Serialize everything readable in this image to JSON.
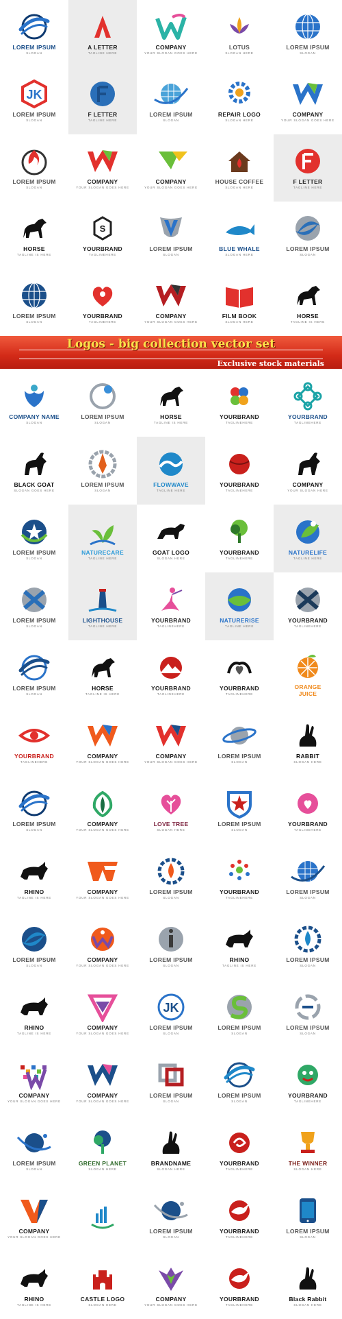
{
  "banner": {
    "title": "Logos - big collection vector set",
    "subtitle": "Exclusive stock materials"
  },
  "logos_top": [
    {
      "icon": "swoosh-circle",
      "c1": "#2a73c9",
      "c2": "#0e3a70",
      "name": "LOREM IPSUM",
      "sub": "SLOGAN",
      "color": "#1b4f8a"
    },
    {
      "icon": "letter-a",
      "c1": "#e2312d",
      "c2": "#333333",
      "name": "A LETTER",
      "sub": "TAGLINE HERE",
      "color": "#222",
      "shade": true
    },
    {
      "icon": "w-ribbon",
      "c1": "#2bb3a6",
      "c2": "#e64f9a",
      "name": "COMPANY",
      "sub": "YOUR SLOGAN GOES HERE",
      "color": "#222"
    },
    {
      "icon": "lotus",
      "c1": "#f0a21c",
      "c2": "#7a4aa8",
      "name": "LOTUS",
      "sub": "SLOGAN HERE",
      "color": "#555"
    },
    {
      "icon": "globe-grid",
      "c1": "#2a73c9",
      "c2": "#9aa3ad",
      "name": "LOREM IPSUM",
      "sub": "SLOGAN",
      "color": "#555"
    },
    {
      "icon": "hex-letter",
      "c1": "#e2312d",
      "c2": "#2a73c9",
      "name": "LOREM IPSUM",
      "sub": "SLOGAN",
      "color": "#555"
    },
    {
      "icon": "letter-f-circle",
      "c1": "#2a6fb8",
      "c2": "#1b4f8a",
      "name": "F LETTER",
      "sub": "TAGLINE HERE",
      "color": "#222",
      "shade": true
    },
    {
      "icon": "globe-swoosh",
      "c1": "#2a73c9",
      "c2": "#4aa3d9",
      "name": "LOREM IPSUM",
      "sub": "SLOGAN",
      "color": "#555"
    },
    {
      "icon": "gear",
      "c1": "#2a73c9",
      "c2": "#f0a21c",
      "name": "REPAIR LOGO",
      "sub": "SLOGAN HERE",
      "color": "#222"
    },
    {
      "icon": "letter-w",
      "c1": "#2a73c9",
      "c2": "#6abf3a",
      "name": "COMPANY",
      "sub": "YOUR SLOGAN GOES HERE",
      "color": "#222"
    },
    {
      "icon": "flame-circle",
      "c1": "#e2312d",
      "c2": "#333333",
      "name": "LOREM IPSUM",
      "sub": "SLOGAN",
      "color": "#555"
    },
    {
      "icon": "letter-w",
      "c1": "#e2312d",
      "c2": "#6abf3a",
      "name": "COMPANY",
      "sub": "YOUR SLOGAN GOES HERE",
      "color": "#222"
    },
    {
      "icon": "fast-arrow",
      "c1": "#6abf3a",
      "c2": "#f0c21c",
      "name": "COMPANY",
      "sub": "YOUR SLOGAN GOES HERE",
      "color": "#222"
    },
    {
      "icon": "house",
      "c1": "#6b3a1e",
      "c2": "#e2312d",
      "name": "HOUSE COFFEE",
      "sub": "SLOGAN HERE",
      "color": "#555"
    },
    {
      "icon": "letter-f-circle",
      "c1": "#e2312d",
      "c2": "#ffffff",
      "name": "F LETTER",
      "sub": "TAGLINE HERE",
      "color": "#222",
      "shade": true
    },
    {
      "icon": "horse",
      "c1": "#111111",
      "c2": "#111111",
      "name": "HORSE",
      "sub": "TAGLINE IS HERE",
      "color": "#111"
    },
    {
      "icon": "s-hex",
      "c1": "#222222",
      "c2": "#222222",
      "name": "YOURBRAND",
      "sub": "TAGLINEHERE",
      "color": "#222"
    },
    {
      "icon": "v-shield",
      "c1": "#2a73c9",
      "c2": "#9aa3ad",
      "name": "LOREM IPSUM",
      "sub": "SLOGAN",
      "color": "#555"
    },
    {
      "icon": "whale",
      "c1": "#1f88c9",
      "c2": "#1f88c9",
      "name": "BLUE WHALE",
      "sub": "SLOGAN HERE",
      "color": "#1b4f8a"
    },
    {
      "icon": "swirl-sphere",
      "c1": "#2a6fb8",
      "c2": "#9aa3ad",
      "name": "LOREM IPSUM",
      "sub": "SLOGAN",
      "color": "#555"
    },
    {
      "icon": "globe-grid",
      "c1": "#1b4f8a",
      "c2": "#2a73c9",
      "name": "LOREM IPSUM",
      "sub": "SLOGAN",
      "color": "#555"
    },
    {
      "icon": "heart-person",
      "c1": "#e2312d",
      "c2": "#222222",
      "name": "YOURBRAND",
      "sub": "TAGLINEHERE",
      "color": "#222"
    },
    {
      "icon": "letter-w",
      "c1": "#b51e22",
      "c2": "#333333",
      "name": "COMPANY",
      "sub": "YOUR SLOGAN GOES HERE",
      "color": "#222"
    },
    {
      "icon": "book",
      "c1": "#e2312d",
      "c2": "#8a1a18",
      "name": "FILM BOOK",
      "sub": "SLOGAN HERE",
      "color": "#222"
    },
    {
      "icon": "horse",
      "c1": "#111111",
      "c2": "#111111",
      "name": "HORSE",
      "sub": "TAGLINE IS HERE",
      "color": "#111"
    }
  ],
  "logos_bottom": [
    {
      "icon": "hands-person",
      "c1": "#2a73c9",
      "c2": "#3aa7c9",
      "name": "COMPANY NAME",
      "sub": "SLOGAN",
      "color": "#1b4f8a"
    },
    {
      "icon": "ring-ball",
      "c1": "#3a8fd9",
      "c2": "#9aa3ad",
      "name": "LOREM IPSUM",
      "sub": "SLOGAN",
      "color": "#555"
    },
    {
      "icon": "horse",
      "c1": "#111111",
      "c2": "#111111",
      "name": "HORSE",
      "sub": "TAGLINE IS HERE",
      "color": "#111"
    },
    {
      "icon": "flower",
      "c1": "#e2312d",
      "c2": "#2a73c9",
      "name": "YOURBRAND",
      "sub": "TAGLINEHERE",
      "color": "#222"
    },
    {
      "icon": "knot",
      "c1": "#1aa3a6",
      "c2": "#1b4f8a",
      "name": "YOURBRAND",
      "sub": "TAGLINEHERE",
      "color": "#1b4f8a"
    },
    {
      "icon": "goat",
      "c1": "#111111",
      "c2": "#111111",
      "name": "BLACK GOAT",
      "sub": "SLOGAN GOES HERE",
      "color": "#111"
    },
    {
      "icon": "rocket-ring",
      "c1": "#e2601c",
      "c2": "#9aa3ad",
      "name": "LOREM IPSUM",
      "sub": "SLOGAN",
      "color": "#555"
    },
    {
      "icon": "wave-circle",
      "c1": "#1f88c9",
      "c2": "#1b4f8a",
      "name": "FLOWWAVE",
      "sub": "TAGLINE HERE",
      "color": "#1f88c9",
      "shade": true
    },
    {
      "icon": "ball-red",
      "c1": "#c9201c",
      "c2": "#7a1210",
      "name": "YOURBRAND",
      "sub": "TAGLINEHERE",
      "color": "#222"
    },
    {
      "icon": "goat",
      "c1": "#111111",
      "c2": "#111111",
      "name": "COMPANY",
      "sub": "YOUR SLOGAN HERE",
      "color": "#111"
    },
    {
      "icon": "star-ring",
      "c1": "#1b4f8a",
      "c2": "#6abf3a",
      "name": "LOREM IPSUM",
      "sub": "SLOGAN",
      "color": "#555"
    },
    {
      "icon": "leaves",
      "c1": "#6abf3a",
      "c2": "#2a73c9",
      "name": "NATURECARE",
      "sub": "TAGLINE HERE",
      "color": "#2a9ad9",
      "shade": true
    },
    {
      "icon": "bull",
      "c1": "#111111",
      "c2": "#111111",
      "name": "GOAT LOGO",
      "sub": "SLOGAN HERE",
      "color": "#111"
    },
    {
      "icon": "tree",
      "c1": "#2f7a2a",
      "c2": "#6abf3a",
      "name": "YOURBRAND",
      "sub": "TAGLINEHERE",
      "color": "#222"
    },
    {
      "icon": "leaf-person",
      "c1": "#2a73c9",
      "c2": "#6abf3a",
      "name": "NATURELIFE",
      "sub": "TAGLINE HERE",
      "color": "#2a73c9",
      "shade": true
    },
    {
      "icon": "x-sphere",
      "c1": "#2a6fb8",
      "c2": "#9aa3ad",
      "name": "LOREM IPSUM",
      "sub": "SLOGAN",
      "color": "#555"
    },
    {
      "icon": "lighthouse",
      "c1": "#1b4f8a",
      "c2": "#1f88c9",
      "name": "LIGHTHOUSE",
      "sub": "TAGLINE HERE",
      "color": "#1b4f8a",
      "shade": true
    },
    {
      "icon": "dancer",
      "c1": "#e64f9a",
      "c2": "#7a4aa8",
      "name": "YOURBRAND",
      "sub": "TAGLINEHERE",
      "color": "#222"
    },
    {
      "icon": "sunrise",
      "c1": "#6abf3a",
      "c2": "#2a73c9",
      "name": "NATURERISE",
      "sub": "TAGLINE HERE",
      "color": "#2a73c9",
      "shade": true
    },
    {
      "icon": "x-sphere",
      "c1": "#1b3a5a",
      "c2": "#9aa3ad",
      "name": "YOURBRAND",
      "sub": "TAGLINEHERE",
      "color": "#222"
    },
    {
      "icon": "swoosh-circle",
      "c1": "#1b4f8a",
      "c2": "#2a73c9",
      "name": "LOREM IPSUM",
      "sub": "SLOGAN",
      "color": "#555"
    },
    {
      "icon": "horse",
      "c1": "#111111",
      "c2": "#111111",
      "name": "HORSE",
      "sub": "TAGLINE IS HERE",
      "color": "#111"
    },
    {
      "icon": "mountain-circle",
      "c1": "#c9201c",
      "c2": "#1b4f8a",
      "name": "YOURBRAND",
      "sub": "TAGLINEHERE",
      "color": "#222"
    },
    {
      "icon": "hands-heart",
      "c1": "#111111",
      "c2": "#555555",
      "name": "YOURBRAND",
      "sub": "TAGLINEHERE",
      "color": "#222"
    },
    {
      "icon": "orange",
      "c1": "#f08a1c",
      "c2": "#6abf3a",
      "name": "ORANGE",
      "name2": "JUICE",
      "sub": "",
      "color": "#f08a1c"
    },
    {
      "icon": "eye",
      "c1": "#e2312d",
      "c2": "#333333",
      "name": "YOURBRAND",
      "sub": "TAGLINEHERE",
      "color": "#c9201c"
    },
    {
      "icon": "letter-w",
      "c1": "#f05a1c",
      "c2": "#2a73c9",
      "name": "COMPANY",
      "sub": "YOUR SLOGAN GOES HERE",
      "color": "#222"
    },
    {
      "icon": "letter-w",
      "c1": "#e2312d",
      "c2": "#1b4f8a",
      "name": "COMPANY",
      "sub": "YOUR SLOGAN GOES HERE",
      "color": "#222"
    },
    {
      "icon": "saturn",
      "c1": "#2a73c9",
      "c2": "#9aa3ad",
      "name": "LOREM IPSUM",
      "sub": "SLOGAN",
      "color": "#555"
    },
    {
      "icon": "rabbit",
      "c1": "#111111",
      "c2": "#111111",
      "name": "RABBIT",
      "sub": "SLOGAN HERE",
      "color": "#111"
    },
    {
      "icon": "swoosh-circle",
      "c1": "#2a73c9",
      "c2": "#0e3a70",
      "name": "LOREM IPSUM",
      "sub": "SLOGAN",
      "color": "#555"
    },
    {
      "icon": "tulip",
      "c1": "#2fa866",
      "c2": "#1b6f44",
      "name": "COMPANY",
      "sub": "YOUR SLOGAN GOES HERE",
      "color": "#222"
    },
    {
      "icon": "heart-tree",
      "c1": "#c9201c",
      "c2": "#e64f9a",
      "name": "LOVE TREE",
      "sub": "SLOGAN HERE",
      "color": "#7a1e3a"
    },
    {
      "icon": "star-shield",
      "c1": "#c9201c",
      "c2": "#2a73c9",
      "name": "LOREM IPSUM",
      "sub": "SLOGAN",
      "color": "#555"
    },
    {
      "icon": "heart-swirl",
      "c1": "#e64f9a",
      "c2": "#c9201c",
      "name": "YOURBRAND",
      "sub": "TAGLINEHERE",
      "color": "#222"
    },
    {
      "icon": "rhino",
      "c1": "#111111",
      "c2": "#111111",
      "name": "RHINO",
      "sub": "TAGLINE IS HERE",
      "color": "#111"
    },
    {
      "icon": "letter-w-bold",
      "c1": "#f05a1c",
      "c2": "#f08a1c",
      "name": "COMPANY",
      "sub": "YOUR SLOGAN GOES HERE",
      "color": "#222"
    },
    {
      "icon": "drop-gear",
      "c1": "#f05a1c",
      "c2": "#1b4f8a",
      "name": "LOREM IPSUM",
      "sub": "SLOGAN",
      "color": "#555"
    },
    {
      "icon": "people-ring",
      "c1": "#e2312d",
      "c2": "#2a73c9",
      "name": "YOURBRAND",
      "sub": "TAGLINEHERE",
      "color": "#222"
    },
    {
      "icon": "globe-swoosh",
      "c1": "#1b4f8a",
      "c2": "#2a73c9",
      "name": "LOREM IPSUM",
      "sub": "SLOGAN",
      "color": "#555"
    },
    {
      "icon": "swirl-sphere",
      "c1": "#1f88c9",
      "c2": "#1b4f8a",
      "name": "LOREM IPSUM",
      "sub": "SLOGAN",
      "color": "#555"
    },
    {
      "icon": "people-w",
      "c1": "#f05a1c",
      "c2": "#7a4aa8",
      "name": "COMPANY",
      "sub": "YOUR SLOGAN GOES HERE",
      "color": "#222"
    },
    {
      "icon": "letter-i",
      "c1": "#3a3a3a",
      "c2": "#9aa3ad",
      "name": "LOREM IPSUM",
      "sub": "SLOGAN",
      "color": "#555"
    },
    {
      "icon": "rhino",
      "c1": "#111111",
      "c2": "#111111",
      "name": "RHINO",
      "sub": "TAGLINE IS HERE",
      "color": "#111"
    },
    {
      "icon": "drop-gear",
      "c1": "#1f88c9",
      "c2": "#1b4f8a",
      "name": "LOREM IPSUM",
      "sub": "SLOGAN",
      "color": "#555"
    },
    {
      "icon": "rhino",
      "c1": "#111111",
      "c2": "#111111",
      "name": "RHINO",
      "sub": "TAGLINE IS HERE",
      "color": "#111"
    },
    {
      "icon": "diamond-w",
      "c1": "#e64f9a",
      "c2": "#7a4aa8",
      "name": "COMPANY",
      "sub": "YOUR SLOGAN GOES HERE",
      "color": "#222"
    },
    {
      "icon": "jk-circle",
      "c1": "#1b4f8a",
      "c2": "#2a73c9",
      "name": "LOREM IPSUM",
      "sub": "SLOGAN",
      "color": "#555"
    },
    {
      "icon": "s-sphere",
      "c1": "#6abf3a",
      "c2": "#9aa3ad",
      "name": "LOREM IPSUM",
      "sub": "SLOGAN",
      "color": "#555"
    },
    {
      "icon": "arrows-circle",
      "c1": "#1b4f8a",
      "c2": "#9aa3ad",
      "name": "LOREM IPSUM",
      "sub": "SLOGAN",
      "color": "#555"
    },
    {
      "icon": "pixel-w",
      "c1": "#c9201c",
      "c2": "#7a4aa8",
      "name": "COMPANY",
      "sub": "YOUR SLOGAN GOES HERE",
      "color": "#222"
    },
    {
      "icon": "letter-w",
      "c1": "#1b4f8a",
      "c2": "#e64f9a",
      "name": "COMPANY",
      "sub": "YOUR SLOGAN GOES HERE",
      "color": "#222"
    },
    {
      "icon": "squares",
      "c1": "#b51e22",
      "c2": "#9aa3ad",
      "name": "LOREM IPSUM",
      "sub": "SLOGAN",
      "color": "#555"
    },
    {
      "icon": "swoosh-circle",
      "c1": "#1f88c9",
      "c2": "#1b4f8a",
      "name": "LOREM IPSUM",
      "sub": "SLOGAN",
      "color": "#555"
    },
    {
      "icon": "face",
      "c1": "#c9201c",
      "c2": "#2fa866",
      "name": "YOURBRAND",
      "sub": "TAGLINEHERE",
      "color": "#222"
    },
    {
      "icon": "planet-swoosh",
      "c1": "#1b4f8a",
      "c2": "#2a73c9",
      "name": "LOREM IPSUM",
      "sub": "SLOGAN",
      "color": "#555"
    },
    {
      "icon": "tree",
      "c1": "#2fa866",
      "c2": "#1b4f8a",
      "name": "GREEN PLANET",
      "sub": "SLOGAN HERE",
      "color": "#2f6a2a"
    },
    {
      "icon": "rabbit",
      "c1": "#111111",
      "c2": "#111111",
      "name": "BRANDNAME",
      "sub": "SLOGAN HERE",
      "color": "#111"
    },
    {
      "icon": "swirl-red",
      "c1": "#c9201c",
      "c2": "#f05a1c",
      "name": "YOURBRAND",
      "sub": "TAGLINEHERE",
      "color": "#222"
    },
    {
      "icon": "trophy",
      "c1": "#f0a21c",
      "c2": "#c9201c",
      "name": "THE WINNER",
      "sub": "SLOGAN HERE",
      "color": "#7a1e18"
    },
    {
      "icon": "letter-v",
      "c1": "#f05a1c",
      "c2": "#1b4f8a",
      "name": "COMPANY",
      "sub": "YOUR SLOGAN GOES HERE",
      "color": "#222"
    },
    {
      "icon": "bars-drop",
      "c1": "#1f88c9",
      "c2": "#2fa866",
      "name": "",
      "sub": "",
      "color": "#222"
    },
    {
      "icon": "planet-swoosh",
      "c1": "#1b4f8a",
      "c2": "#9aa3ad",
      "name": "LOREM IPSUM",
      "sub": "SLOGAN",
      "color": "#555"
    },
    {
      "icon": "bird",
      "c1": "#c9201c",
      "c2": "#f05a1c",
      "name": "YOURBRAND",
      "sub": "TAGLINEHERE",
      "color": "#222"
    },
    {
      "icon": "phone",
      "c1": "#1b4f8a",
      "c2": "#1f88c9",
      "name": "LOREM IPSUM",
      "sub": "SLOGAN",
      "color": "#555"
    },
    {
      "icon": "rhino",
      "c1": "#111111",
      "c2": "#111111",
      "name": "RHINO",
      "sub": "TAGLINE IS HERE",
      "color": "#111"
    },
    {
      "icon": "castle",
      "c1": "#c9201c",
      "c2": "#f0a21c",
      "name": "CASTLE LOGO",
      "sub": "SLOGAN HERE",
      "color": "#222"
    },
    {
      "icon": "wings",
      "c1": "#7a4aa8",
      "c2": "#6abf3a",
      "name": "COMPANY",
      "sub": "YOUR SLOGAN GOES HERE",
      "color": "#222"
    },
    {
      "icon": "bird",
      "c1": "#c9201c",
      "c2": "#e64f9a",
      "name": "YOURBRAND",
      "sub": "TAGLINEHERE",
      "color": "#222"
    },
    {
      "icon": "rabbit",
      "c1": "#111111",
      "c2": "#111111",
      "name": "Black Rabbit",
      "sub": "SLOGAN HERE",
      "color": "#111"
    }
  ]
}
